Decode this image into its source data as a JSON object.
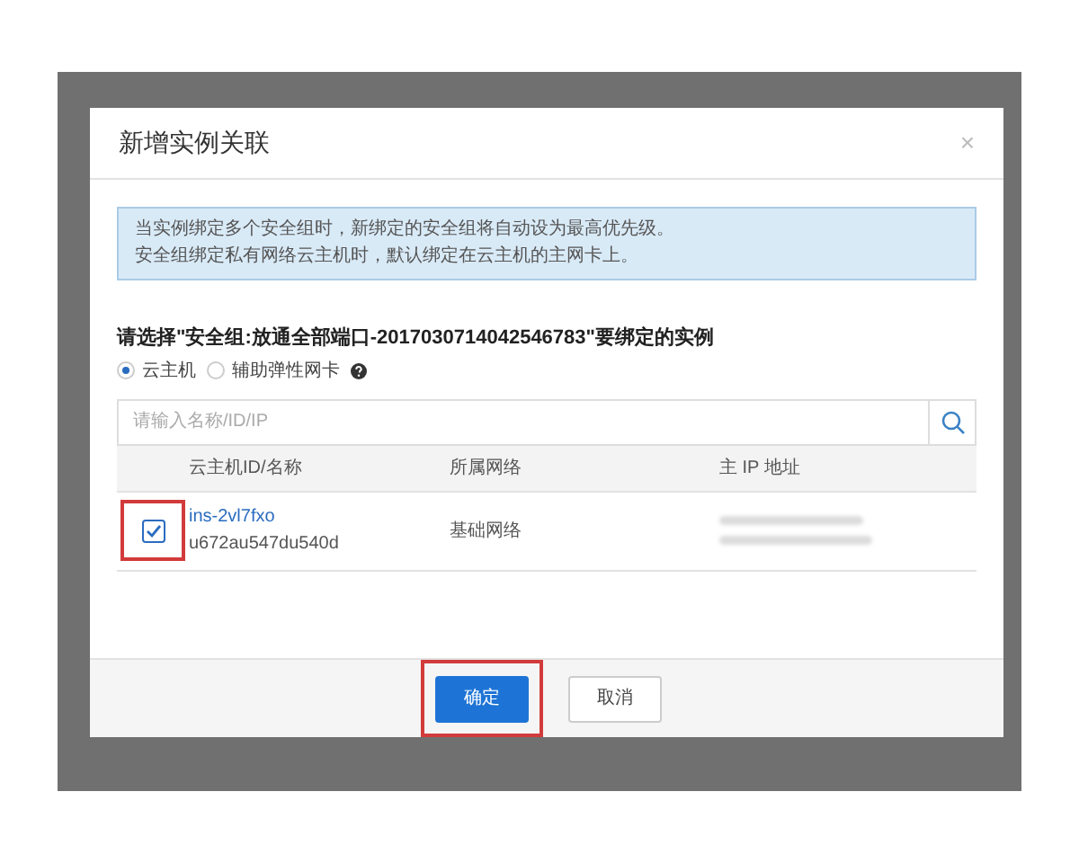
{
  "dialog": {
    "title": "新增实例关联",
    "close": "×"
  },
  "notice": [
    "当实例绑定多个安全组时，新绑定的安全组将自动设为最高优先级。",
    "安全组绑定私有网络云主机时，默认绑定在云主机的主网卡上。"
  ],
  "prompt": "请选择\"安全组:放通全部端口-2017030714042546783\"要绑定的实例",
  "radios": [
    {
      "label": "云主机",
      "selected": true
    },
    {
      "label": "辅助弹性网卡",
      "selected": false
    }
  ],
  "search": {
    "placeholder": "请输入名称/ID/IP"
  },
  "table": {
    "columns": [
      "云主机ID/名称",
      "所属网络",
      "主 IP 地址"
    ],
    "rows": [
      {
        "checked": true,
        "highlighted": true,
        "id": "ins-2vl7fxo",
        "name": "u672au547du540d",
        "network": "基础网络"
      }
    ]
  },
  "buttons": [
    {
      "label": "确定",
      "kind": "primary",
      "highlighted": true
    },
    {
      "label": "取消",
      "kind": "secondary",
      "highlighted": false
    }
  ]
}
